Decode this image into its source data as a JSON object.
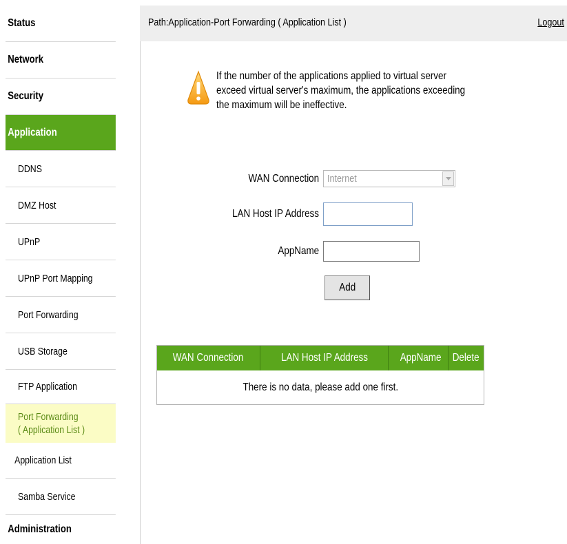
{
  "sidebar": {
    "items": [
      {
        "label": "Status"
      },
      {
        "label": "Network"
      },
      {
        "label": "Security"
      },
      {
        "label": "Application"
      },
      {
        "label": "DDNS"
      },
      {
        "label": "DMZ Host"
      },
      {
        "label": "UPnP"
      },
      {
        "label": "UPnP Port Mapping"
      },
      {
        "label": "Port Forwarding"
      },
      {
        "label": "USB Storage"
      },
      {
        "label": "FTP Application"
      },
      {
        "label_line1": "Port Forwarding",
        "label_line2": "( Application List )"
      },
      {
        "label": "Application List"
      },
      {
        "label": "Samba Service"
      },
      {
        "label": "Administration"
      }
    ]
  },
  "header": {
    "path": "Path:Application-Port Forwarding ( Application List )",
    "logout": "Logout"
  },
  "warning": {
    "line1": "If the number of the applications applied to virtual server",
    "line2": "exceed virtual server's maximum, the applications exceeding",
    "line3": "the maximum will be ineffective."
  },
  "form": {
    "wan_label": "WAN Connection",
    "wan_value": "Internet",
    "lan_label": "LAN Host IP Address",
    "lan_value": "",
    "app_label": "AppName",
    "app_value": "",
    "add_button": "Add"
  },
  "table": {
    "columns": [
      "WAN Connection",
      "LAN Host IP Address",
      "AppName",
      "Delete"
    ],
    "empty_message": "There is no data, please add one first."
  },
  "colors": {
    "accent_green": "#5aa61c",
    "current_item_bg": "#fbfcc5",
    "header_bg": "#eeeeee"
  }
}
